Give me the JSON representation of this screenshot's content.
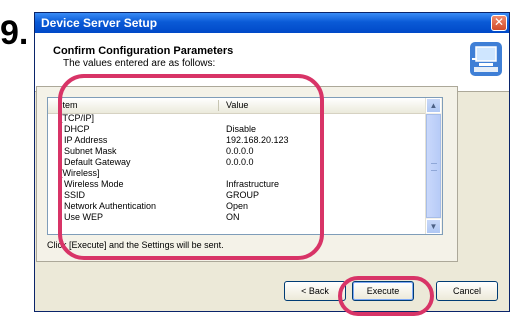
{
  "step_number": "9.",
  "window": {
    "title": "Device Server Setup",
    "close_glyph": "✕"
  },
  "header": {
    "title": "Confirm Configuration Parameters",
    "subtitle": "The values entered are as follows:",
    "icon": "computer-network-icon"
  },
  "list": {
    "columns": [
      "Item",
      "Value"
    ],
    "rows": [
      {
        "item": "[TCP/IP]",
        "value": "",
        "indent": false
      },
      {
        "item": "DHCP",
        "value": "Disable",
        "indent": true
      },
      {
        "item": "IP Address",
        "value": "192.168.20.123",
        "indent": true
      },
      {
        "item": "Subnet Mask",
        "value": "0.0.0.0",
        "indent": true
      },
      {
        "item": "Default Gateway",
        "value": "0.0.0.0",
        "indent": true
      },
      {
        "item": "[Wireless]",
        "value": "",
        "indent": false
      },
      {
        "item": "Wireless Mode",
        "value": "Infrastructure",
        "indent": true
      },
      {
        "item": "SSID",
        "value": "GROUP",
        "indent": true
      },
      {
        "item": "Network Authentication",
        "value": "Open",
        "indent": true
      },
      {
        "item": "Use WEP",
        "value": "ON",
        "indent": true
      }
    ]
  },
  "note": "Click [Execute] and the Settings will be sent.",
  "buttons": {
    "back": "< Back",
    "execute": "Execute",
    "cancel": "Cancel"
  },
  "colors": {
    "highlight": "#d83467",
    "titlebar": "#0a5ad6"
  }
}
